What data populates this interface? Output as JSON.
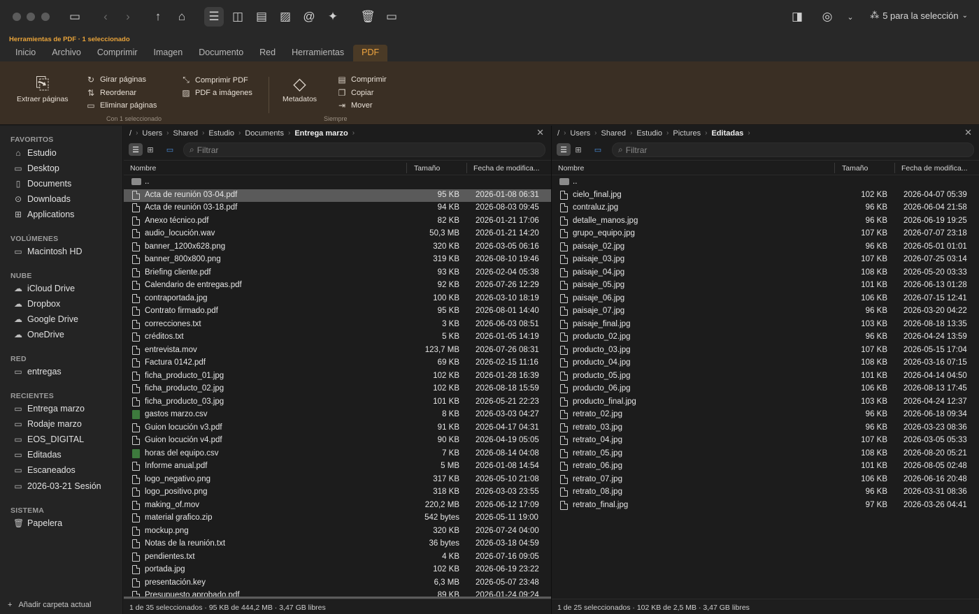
{
  "titlebar": {
    "selection_label": "5 para la selección"
  },
  "ribbon": {
    "context_label": "Herramientas de PDF · 1 seleccionado",
    "tabs": [
      "Inicio",
      "Archivo",
      "Comprimir",
      "Imagen",
      "Documento",
      "Red",
      "Herramientas",
      "PDF"
    ],
    "active_tab": "PDF",
    "extract_pages": "Extraer páginas",
    "rotate_pages": "Girar páginas",
    "reorder": "Reordenar",
    "delete_pages": "Eliminar páginas",
    "group1_label": "Con 1 seleccionado",
    "compress_pdf": "Comprimir PDF",
    "pdf_to_images": "PDF a imágenes",
    "metadata": "Metadatos",
    "compress": "Comprimir",
    "copy": "Copiar",
    "move": "Mover",
    "group2_label": "Siempre"
  },
  "sidebar": {
    "sections": [
      {
        "title": "FAVORITOS",
        "items": [
          {
            "label": "Estudio",
            "icon": "home-icon"
          },
          {
            "label": "Desktop",
            "icon": "desktop-icon"
          },
          {
            "label": "Documents",
            "icon": "document-icon"
          },
          {
            "label": "Downloads",
            "icon": "download-icon"
          },
          {
            "label": "Applications",
            "icon": "apps-icon"
          }
        ]
      },
      {
        "title": "VOLÚMENES",
        "items": [
          {
            "label": "Macintosh HD",
            "icon": "disk-icon"
          }
        ]
      },
      {
        "title": "NUBE",
        "items": [
          {
            "label": "iCloud Drive",
            "icon": "cloud-icon"
          },
          {
            "label": "Dropbox",
            "icon": "cloud-icon"
          },
          {
            "label": "Google Drive",
            "icon": "cloud-icon"
          },
          {
            "label": "OneDrive",
            "icon": "cloud-icon"
          }
        ]
      },
      {
        "title": "RED",
        "items": [
          {
            "label": "entregas",
            "icon": "network-drive-icon"
          }
        ]
      },
      {
        "title": "RECIENTES",
        "items": [
          {
            "label": "Entrega marzo",
            "icon": "folder-icon"
          },
          {
            "label": "Rodaje marzo",
            "icon": "folder-icon"
          },
          {
            "label": "EOS_DIGITAL",
            "icon": "folder-icon"
          },
          {
            "label": "Editadas",
            "icon": "folder-icon"
          },
          {
            "label": "Escaneados",
            "icon": "folder-icon"
          },
          {
            "label": "2026-03-21 Sesión",
            "icon": "folder-icon"
          }
        ]
      },
      {
        "title": "SISTEMA",
        "items": [
          {
            "label": "Papelera",
            "icon": "trash-icon"
          }
        ]
      }
    ],
    "add_folder": "Añadir carpeta actual"
  },
  "left_pane": {
    "root": "/",
    "breadcrumb": [
      "Users",
      "Shared",
      "Estudio",
      "Documents",
      "Entrega marzo"
    ],
    "filter_placeholder": "Filtrar",
    "columns": {
      "name": "Nombre",
      "size": "Tamaño",
      "date": "Fecha de modifica..."
    },
    "parent": "..",
    "files": [
      {
        "name": "Acta de reunión 03-04.pdf",
        "size": "95 KB",
        "date": "2026-01-08 06:31",
        "selected": true
      },
      {
        "name": "Acta de reunión 03-18.pdf",
        "size": "94 KB",
        "date": "2026-08-03 09:45"
      },
      {
        "name": "Anexo técnico.pdf",
        "size": "82 KB",
        "date": "2026-01-21 17:06"
      },
      {
        "name": "audio_locución.wav",
        "size": "50,3 MB",
        "date": "2026-01-21 14:20"
      },
      {
        "name": "banner_1200x628.png",
        "size": "320 KB",
        "date": "2026-03-05 06:16"
      },
      {
        "name": "banner_800x800.png",
        "size": "319 KB",
        "date": "2026-08-10 19:46"
      },
      {
        "name": "Briefing cliente.pdf",
        "size": "93 KB",
        "date": "2026-02-04 05:38"
      },
      {
        "name": "Calendario de entregas.pdf",
        "size": "92 KB",
        "date": "2026-07-26 12:29"
      },
      {
        "name": "contraportada.jpg",
        "size": "100 KB",
        "date": "2026-03-10 18:19"
      },
      {
        "name": "Contrato firmado.pdf",
        "size": "95 KB",
        "date": "2026-08-01 14:40"
      },
      {
        "name": "correcciones.txt",
        "size": "3 KB",
        "date": "2026-06-03 08:51"
      },
      {
        "name": "créditos.txt",
        "size": "5 KB",
        "date": "2026-01-05 14:19"
      },
      {
        "name": "entrevista.mov",
        "size": "123,7 MB",
        "date": "2026-07-26 08:31"
      },
      {
        "name": "Factura 0142.pdf",
        "size": "69 KB",
        "date": "2026-02-15 11:16"
      },
      {
        "name": "ficha_producto_01.jpg",
        "size": "102 KB",
        "date": "2026-01-28 16:39"
      },
      {
        "name": "ficha_producto_02.jpg",
        "size": "102 KB",
        "date": "2026-08-18 15:59"
      },
      {
        "name": "ficha_producto_03.jpg",
        "size": "101 KB",
        "date": "2026-05-21 22:23"
      },
      {
        "name": "gastos marzo.csv",
        "size": "8 KB",
        "date": "2026-03-03 04:27",
        "csv": true
      },
      {
        "name": "Guion locución v3.pdf",
        "size": "91 KB",
        "date": "2026-04-17 04:31"
      },
      {
        "name": "Guion locución v4.pdf",
        "size": "90 KB",
        "date": "2026-04-19 05:05"
      },
      {
        "name": "horas del equipo.csv",
        "size": "7 KB",
        "date": "2026-08-14 04:08",
        "csv": true
      },
      {
        "name": "Informe anual.pdf",
        "size": "5 MB",
        "date": "2026-01-08 14:54"
      },
      {
        "name": "logo_negativo.png",
        "size": "317 KB",
        "date": "2026-05-10 21:08"
      },
      {
        "name": "logo_positivo.png",
        "size": "318 KB",
        "date": "2026-03-03 23:55"
      },
      {
        "name": "making_of.mov",
        "size": "220,2 MB",
        "date": "2026-06-12 17:09"
      },
      {
        "name": "material grafico.zip",
        "size": "542 bytes",
        "date": "2026-05-11 19:00"
      },
      {
        "name": "mockup.png",
        "size": "320 KB",
        "date": "2026-07-24 04:00"
      },
      {
        "name": "Notas de la reunión.txt",
        "size": "36 bytes",
        "date": "2026-03-18 04:59"
      },
      {
        "name": "pendientes.txt",
        "size": "4 KB",
        "date": "2026-07-16 09:05"
      },
      {
        "name": "portada.jpg",
        "size": "102 KB",
        "date": "2026-06-19 23:22"
      },
      {
        "name": "presentación.key",
        "size": "6,3 MB",
        "date": "2026-05-07 23:48"
      },
      {
        "name": "Presupuesto aprobado.pdf",
        "size": "89 KB",
        "date": "2026-01-24 09:24"
      }
    ],
    "status": "1 de 35 seleccionados · 95 KB de 444,2 MB · 3,47 GB libres"
  },
  "right_pane": {
    "root": "/",
    "breadcrumb": [
      "Users",
      "Shared",
      "Estudio",
      "Pictures",
      "Editadas"
    ],
    "filter_placeholder": "Filtrar",
    "columns": {
      "name": "Nombre",
      "size": "Tamaño",
      "date": "Fecha de modifica..."
    },
    "parent": "..",
    "files": [
      {
        "name": "cielo_final.jpg",
        "size": "102 KB",
        "date": "2026-04-07 05:39"
      },
      {
        "name": "contraluz.jpg",
        "size": "96 KB",
        "date": "2026-06-04 21:58"
      },
      {
        "name": "detalle_manos.jpg",
        "size": "96 KB",
        "date": "2026-06-19 19:25"
      },
      {
        "name": "grupo_equipo.jpg",
        "size": "107 KB",
        "date": "2026-07-07 23:18"
      },
      {
        "name": "paisaje_02.jpg",
        "size": "96 KB",
        "date": "2026-05-01 01:01"
      },
      {
        "name": "paisaje_03.jpg",
        "size": "107 KB",
        "date": "2026-07-25 03:14"
      },
      {
        "name": "paisaje_04.jpg",
        "size": "108 KB",
        "date": "2026-05-20 03:33"
      },
      {
        "name": "paisaje_05.jpg",
        "size": "101 KB",
        "date": "2026-06-13 01:28"
      },
      {
        "name": "paisaje_06.jpg",
        "size": "106 KB",
        "date": "2026-07-15 12:41"
      },
      {
        "name": "paisaje_07.jpg",
        "size": "96 KB",
        "date": "2026-03-20 04:22"
      },
      {
        "name": "paisaje_final.jpg",
        "size": "103 KB",
        "date": "2026-08-18 13:35"
      },
      {
        "name": "producto_02.jpg",
        "size": "96 KB",
        "date": "2026-04-24 13:59"
      },
      {
        "name": "producto_03.jpg",
        "size": "107 KB",
        "date": "2026-05-15 17:04"
      },
      {
        "name": "producto_04.jpg",
        "size": "108 KB",
        "date": "2026-03-16 07:15"
      },
      {
        "name": "producto_05.jpg",
        "size": "101 KB",
        "date": "2026-04-14 04:50"
      },
      {
        "name": "producto_06.jpg",
        "size": "106 KB",
        "date": "2026-08-13 17:45"
      },
      {
        "name": "producto_final.jpg",
        "size": "103 KB",
        "date": "2026-04-24 12:37"
      },
      {
        "name": "retrato_02.jpg",
        "size": "96 KB",
        "date": "2026-06-18 09:34"
      },
      {
        "name": "retrato_03.jpg",
        "size": "96 KB",
        "date": "2026-03-23 08:36"
      },
      {
        "name": "retrato_04.jpg",
        "size": "107 KB",
        "date": "2026-03-05 05:33"
      },
      {
        "name": "retrato_05.jpg",
        "size": "108 KB",
        "date": "2026-08-20 05:21"
      },
      {
        "name": "retrato_06.jpg",
        "size": "101 KB",
        "date": "2026-08-05 02:48"
      },
      {
        "name": "retrato_07.jpg",
        "size": "106 KB",
        "date": "2026-06-16 20:48"
      },
      {
        "name": "retrato_08.jpg",
        "size": "96 KB",
        "date": "2026-03-31 08:36"
      },
      {
        "name": "retrato_final.jpg",
        "size": "97 KB",
        "date": "2026-03-26 04:41"
      }
    ],
    "status": "1 de 25 seleccionados · 102 KB de 2,5 MB · 3,47 GB libres"
  },
  "colors": {
    "accent": "#f0a640",
    "ribbon_bg": "#3a2f24",
    "selection": "#5a5a5a"
  }
}
